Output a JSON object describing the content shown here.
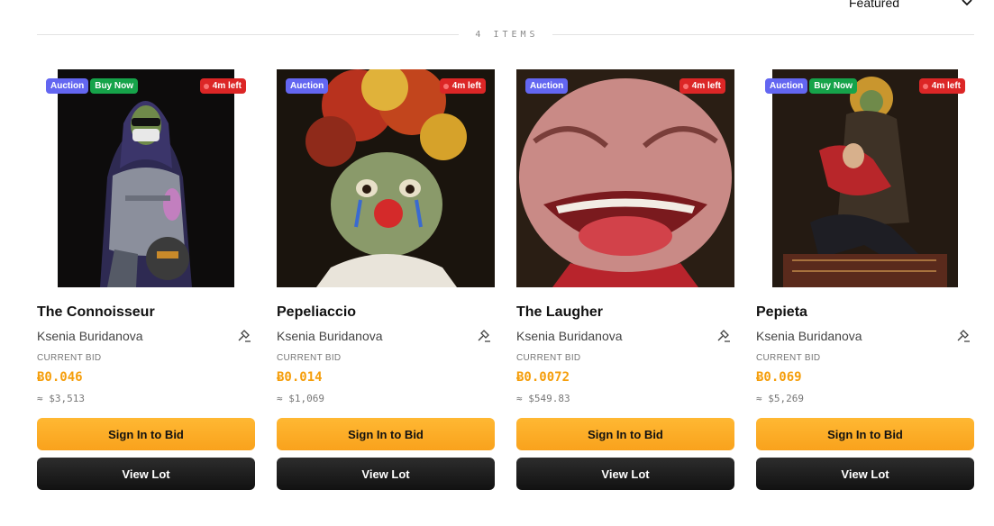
{
  "sort": {
    "selected": "Featured"
  },
  "items_count_label": "4 ITEMS",
  "lots": [
    {
      "title": "The Connoisseur",
      "artist": "Ksenia Buridanova",
      "badges": [
        "Auction",
        "Buy Now"
      ],
      "time_left": "4m left",
      "bid_label": "CURRENT BID",
      "bid": "Ƀ0.046",
      "usd": "≈ $3,513",
      "bid_button": "Sign In to Bid",
      "view_button": "View Lot"
    },
    {
      "title": "Pepeliaccio",
      "artist": "Ksenia Buridanova",
      "badges": [
        "Auction"
      ],
      "time_left": "4m left",
      "bid_label": "CURRENT BID",
      "bid": "Ƀ0.014",
      "usd": "≈ $1,069",
      "bid_button": "Sign In to Bid",
      "view_button": "View Lot"
    },
    {
      "title": "The Laugher",
      "artist": "Ksenia Buridanova",
      "badges": [
        "Auction"
      ],
      "time_left": "4m left",
      "bid_label": "CURRENT BID",
      "bid": "Ƀ0.0072",
      "usd": "≈ $549.83",
      "bid_button": "Sign In to Bid",
      "view_button": "View Lot"
    },
    {
      "title": "Pepieta",
      "artist": "Ksenia Buridanova",
      "badges": [
        "Auction",
        "Buy Now"
      ],
      "time_left": "4m left",
      "bid_label": "CURRENT BID",
      "bid": "Ƀ0.069",
      "usd": "≈ $5,269",
      "bid_button": "Sign In to Bid",
      "view_button": "View Lot"
    }
  ],
  "colors": {
    "accent": "#f59e0b",
    "auction_badge": "#6366f1",
    "buynow_badge": "#16a34a",
    "timer_badge": "#dc2626"
  }
}
